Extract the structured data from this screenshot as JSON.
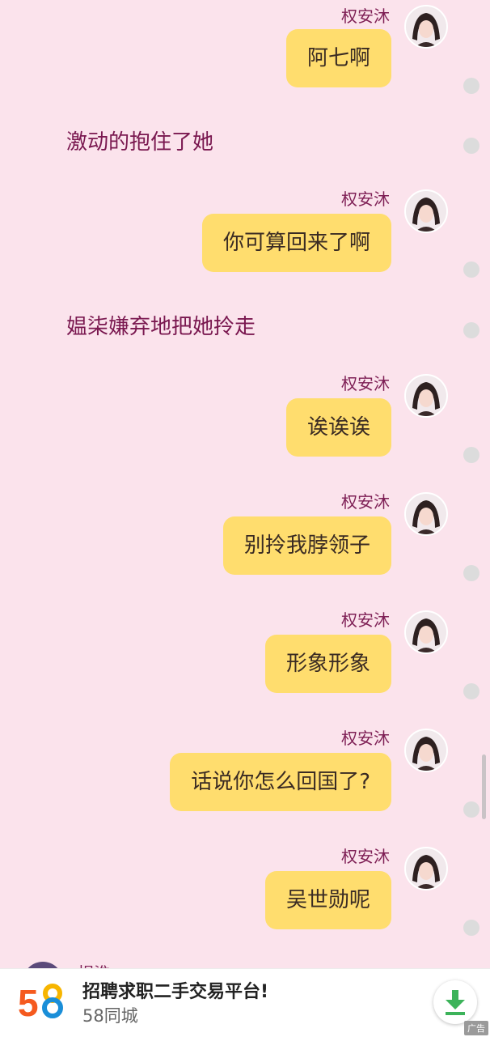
{
  "messages": [
    {
      "type": "sent",
      "sender": "权安沐",
      "text": "阿七啊"
    },
    {
      "type": "narration",
      "text": "激动的抱住了她"
    },
    {
      "type": "sent",
      "sender": "权安沐",
      "text": "你可算回来了啊"
    },
    {
      "type": "narration",
      "text": "媪柒嫌弃地把她拎走"
    },
    {
      "type": "sent",
      "sender": "权安沐",
      "text": "诶诶诶"
    },
    {
      "type": "sent",
      "sender": "权安沐",
      "text": "别拎我脖领子"
    },
    {
      "type": "sent",
      "sender": "权安沐",
      "text": "形象形象"
    },
    {
      "type": "sent",
      "sender": "权安沐",
      "text": "话说你怎么回国了?"
    },
    {
      "type": "sent",
      "sender": "权安沐",
      "text": "吴世勋呢"
    }
  ],
  "peek": {
    "name": "捍淮"
  },
  "ad": {
    "logo": "58",
    "title": "招聘求职二手交易平台!",
    "subtitle": "58同城",
    "tag": "广告",
    "download_icon": "download-icon"
  },
  "colors": {
    "background": "#fbe3ec",
    "bubble": "#ffdd6e",
    "name": "#7e1f55",
    "narration": "#7a1850"
  }
}
